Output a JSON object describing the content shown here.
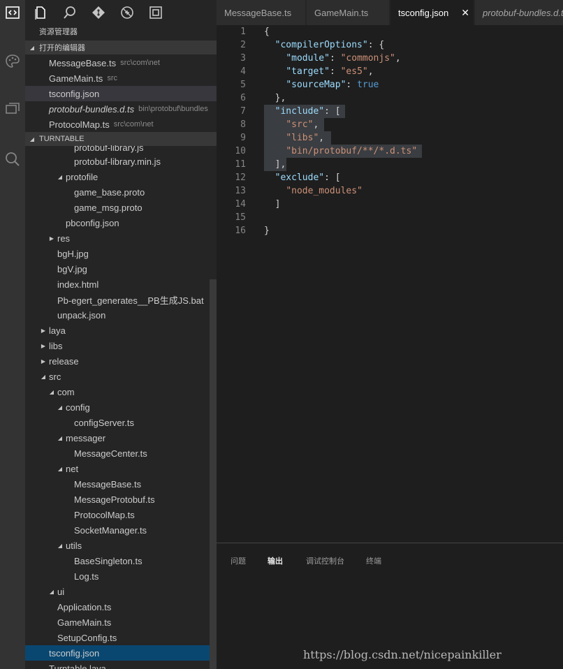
{
  "activity_bar": [
    "explorer-icon",
    "extensions-icon",
    "remote-icon",
    "search-icon"
  ],
  "sidebar": {
    "toolbar": [
      "new-file-icon",
      "search-icon",
      "git-icon",
      "debug-icon",
      "extensions-icon"
    ],
    "title": "资源管理器",
    "open_editors_header": "打开的编辑器",
    "open_editors": [
      {
        "name": "MessageBase.ts",
        "path": "src\\com\\net"
      },
      {
        "name": "GameMain.ts",
        "path": "src"
      },
      {
        "name": "tsconfig.json",
        "path": ""
      },
      {
        "name": "protobuf-bundles.d.ts",
        "path": "bin\\protobuf\\bundles"
      },
      {
        "name": "ProtocolMap.ts",
        "path": "src\\com\\net"
      }
    ],
    "project_header": "TURNTABLE",
    "tree": [
      {
        "label": "protobuf-library.js"
      },
      {
        "label": "protobuf-library.min.js"
      },
      {
        "label": "protofile"
      },
      {
        "label": "game_base.proto"
      },
      {
        "label": "game_msg.proto"
      },
      {
        "label": "pbconfig.json"
      },
      {
        "label": "res"
      },
      {
        "label": "bgH.jpg"
      },
      {
        "label": "bgV.jpg"
      },
      {
        "label": "index.html"
      },
      {
        "label": "Pb-egert_generates__PB生成JS.bat"
      },
      {
        "label": "unpack.json"
      },
      {
        "label": "laya"
      },
      {
        "label": "libs"
      },
      {
        "label": "release"
      },
      {
        "label": "src"
      },
      {
        "label": "com"
      },
      {
        "label": "config"
      },
      {
        "label": "configServer.ts"
      },
      {
        "label": "messager"
      },
      {
        "label": "MessageCenter.ts"
      },
      {
        "label": "net"
      },
      {
        "label": "MessageBase.ts"
      },
      {
        "label": "MessageProtobuf.ts"
      },
      {
        "label": "ProtocolMap.ts"
      },
      {
        "label": "SocketManager.ts"
      },
      {
        "label": "utils"
      },
      {
        "label": "BaseSingleton.ts"
      },
      {
        "label": "Log.ts"
      },
      {
        "label": "ui"
      },
      {
        "label": "Application.ts"
      },
      {
        "label": "GameMain.ts"
      },
      {
        "label": "SetupConfig.ts"
      },
      {
        "label": "tsconfig.json"
      },
      {
        "label": "Turntable.laya"
      }
    ]
  },
  "editor": {
    "tabs": [
      {
        "label": "MessageBase.ts"
      },
      {
        "label": "GameMain.ts"
      },
      {
        "label": "tsconfig.json",
        "close": "✕"
      },
      {
        "label": "protobuf-bundles.d.ts"
      }
    ],
    "line_numbers": [
      "1",
      "2",
      "3",
      "4",
      "5",
      "6",
      "7",
      "8",
      "9",
      "10",
      "11",
      "12",
      "13",
      "14",
      "15",
      "16"
    ],
    "code": {
      "l1": "{",
      "compilerOptions": "\"compilerOptions\"",
      "module_key": "\"module\"",
      "module_val": "\"commonjs\"",
      "target_key": "\"target\"",
      "target_val": "\"es5\"",
      "sourcemap_key": "\"sourceMap\"",
      "sourcemap_val": "true",
      "l6": "},",
      "include_key": "\"include\"",
      "inc1": "\"src\"",
      "inc2": "\"libs\"",
      "inc3": "\"bin/protobuf/**/*.d.ts\"",
      "l11": "],",
      "exclude_key": "\"exclude\"",
      "exc1": "\"node_modules\"",
      "l14": "]",
      "l16": "}"
    }
  },
  "panel": {
    "tabs": [
      "问题",
      "输出",
      "调试控制台",
      "终端"
    ]
  },
  "watermark": "https://blog.csdn.net/nicepainkiller"
}
